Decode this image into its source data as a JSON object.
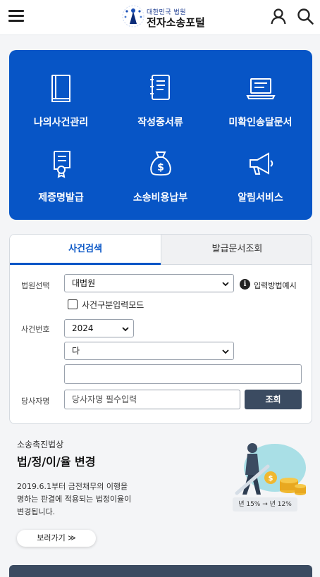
{
  "header": {
    "logo_sub": "대한민국 법원",
    "logo_title": "전자소송포털"
  },
  "menu": {
    "items": [
      {
        "label": "나의사건관리",
        "icon": "book-icon"
      },
      {
        "label": "작성중서류",
        "icon": "notebook-icon"
      },
      {
        "label": "미확인송달문서",
        "icon": "laptop-icon"
      },
      {
        "label": "제증명발급",
        "icon": "certificate-icon"
      },
      {
        "label": "소송비용납부",
        "icon": "money-bag-icon"
      },
      {
        "label": "알림서비스",
        "icon": "megaphone-icon"
      }
    ]
  },
  "search": {
    "tabs": [
      "사건검색",
      "발급문서조회"
    ],
    "court_label": "법원선택",
    "court_value": "대법원",
    "help_text": "입력방법예시",
    "checkbox_label": "사건구분입력모드",
    "case_no_label": "사건번호",
    "year_value": "2024",
    "type_value": "다",
    "number_value": "",
    "party_label": "당사자명",
    "party_placeholder": "당사자명 필수입력",
    "query_button": "조회"
  },
  "banner": {
    "small": "소송촉진법상",
    "big": "법/정/이/율 변경",
    "desc_1": "2019.6.1부터 금전채무의 이행을",
    "desc_2": "명하는 판결에 적용되는 법정이율이",
    "desc_3": "변경됩니다.",
    "more_button": "보러가기 ≫",
    "rate_before": "15%",
    "rate_after": "12%"
  },
  "colors": {
    "primary": "#0755c6",
    "dark_button": "#3b4b61",
    "background": "#f4f5f7"
  }
}
